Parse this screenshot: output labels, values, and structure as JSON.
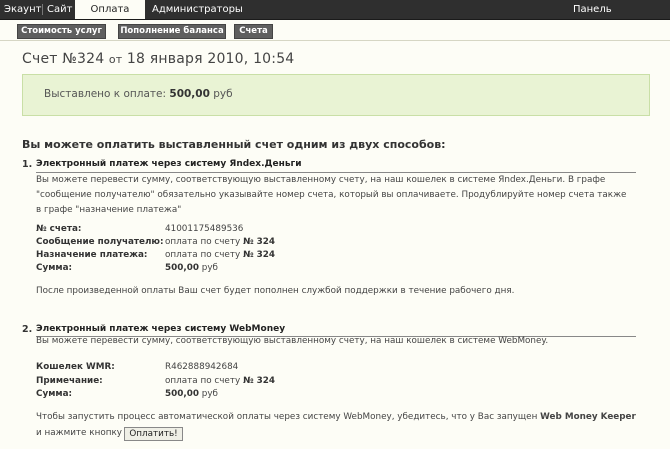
{
  "nav": {
    "tabs": [
      {
        "label": "Экаунт"
      },
      {
        "label": "Сайт"
      },
      {
        "label": "Оплата услуг"
      },
      {
        "label": "Администраторы"
      }
    ],
    "right_label": "Панель управления"
  },
  "subnav": {
    "buttons": [
      {
        "label": "Стоимость услуг"
      },
      {
        "label": "Пополнение баланса"
      },
      {
        "label": "Счета"
      }
    ]
  },
  "invoice": {
    "title_prefix": "Счет №324",
    "title_date_word": "от",
    "title_date": "18 января 2010, 10:54",
    "amount_label": "Выставлено к оплате:",
    "amount_value": "500,00",
    "amount_currency": "руб"
  },
  "methods_heading": "Вы можете оплатить выставленный счет одним из двух способов:",
  "yandex": {
    "number": "1.",
    "title": "Электронный платеж через систему Яndex.Деньги",
    "intro_line1": "Вы можете перевести сумму, соответствующую выставленному счету, на наш кошелек в системе Яndex.Деньги. В графе",
    "intro_line2": "\"сообщение получателю\" обязательно указывайте номер счета, который вы оплачиваете. Продублируйте номер счета также",
    "intro_line3": "в графе \"назначение платежа\"",
    "fields": [
      {
        "label": "№ счета:",
        "value": "41001175489536",
        "bold_part": ""
      },
      {
        "label": "Сообщение получателю:",
        "value": "оплата по счету",
        "bold_part": "№ 324"
      },
      {
        "label": "Назначение платежа:",
        "value": "оплата по счету",
        "bold_part": "№ 324"
      },
      {
        "label": "Сумма:",
        "value": "руб",
        "bold_part": "500,00"
      }
    ],
    "footer": "После произведенной оплаты Ваш счет будет пополнен службой поддержки в течение рабочего дня."
  },
  "webmoney": {
    "number": "2.",
    "title": "Электронный платеж через систему WebMoney",
    "intro": "Вы можете перевести сумму, соответствующую выставленному счету, на наш кошелек в системе WebMoney.",
    "fields": [
      {
        "label": "Кошелек WMR:",
        "value": "R462888942684",
        "bold_part": ""
      },
      {
        "label": "Примечание:",
        "value": "оплата по счету",
        "bold_part": "№ 324"
      },
      {
        "label": "Сумма:",
        "value": "руб",
        "bold_part": "500,00"
      }
    ],
    "auto_text": "Чтобы запустить процесс автоматической оплаты через систему WebMoney, убедитесь, что у Вас запущен",
    "auto_bold": "Web Money Keeper",
    "press_text": "и нажмите кнопку",
    "pay_button": "Оплатить!"
  }
}
